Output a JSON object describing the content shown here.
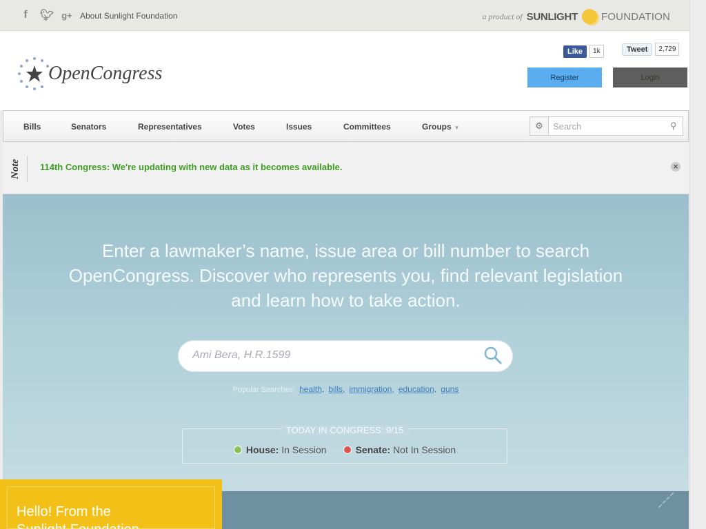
{
  "topbar": {
    "social_icons": [
      "facebook-icon",
      "twitter-icon",
      "google-plus-icon"
    ],
    "about_link": "About Sunlight Foundation",
    "product_prefix": "a product of",
    "brand_bold": "SUNLIGHT",
    "brand_light": "FOUNDATION"
  },
  "header": {
    "logo_text": "OpenCongress",
    "facebook": {
      "label": "Like",
      "count": "1k"
    },
    "twitter": {
      "label": "Tweet",
      "count": "2,729"
    },
    "register_label": "Register",
    "login_label": "Login"
  },
  "nav": {
    "items": [
      "Bills",
      "Senators",
      "Representatives",
      "Votes",
      "Issues",
      "Committees",
      "Groups"
    ],
    "search_placeholder": "Search"
  },
  "note": {
    "label": "Note",
    "message": "114th Congress: We're updating with new data as it becomes available."
  },
  "hero": {
    "headline": "Enter a lawmaker’s name, issue area or bill number to search OpenCongress. Discover who represents you, find relevant legislation and learn how to take action.",
    "search_placeholder": "Ami Bera, H.R.1599",
    "popular_label": "Popular Searches:",
    "popular": [
      "health,",
      "bills,",
      "immigration,",
      "education,",
      "guns"
    ],
    "today_title": "TODAY IN CONGRESS: 9/15",
    "house_label": "House:",
    "house_status": "In Session",
    "senate_label": "Senate:",
    "senate_status": "Not In Session"
  },
  "popup": {
    "line1": "Hello! From the",
    "line2": "Sunlight Foundation"
  },
  "colors": {
    "accent_blue": "#5aaef0",
    "note_green": "#3e9c22",
    "popup_yellow": "#f3c018"
  }
}
